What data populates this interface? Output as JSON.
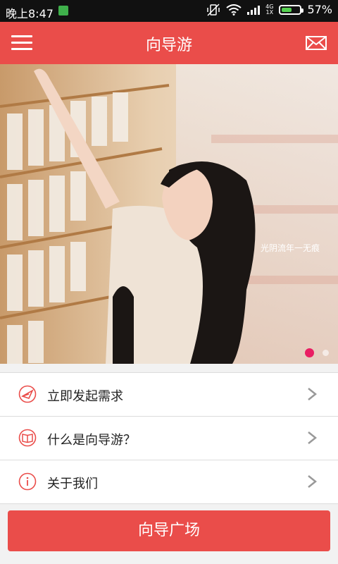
{
  "status_bar": {
    "time": "晚上8:47",
    "battery_percent_label": "57%",
    "battery_level": 0.57,
    "network_top": "4G",
    "network_bottom": "1X"
  },
  "header": {
    "title": "向导游",
    "menu_icon": "hamburger-icon",
    "mail_icon": "envelope-icon"
  },
  "banner": {
    "watermark": "光阴流年一无痕",
    "page_indicator": {
      "count": 2,
      "active": 1
    }
  },
  "menu": {
    "items": [
      {
        "label": "立即发起需求",
        "icon": "send-request-icon"
      },
      {
        "label": "什么是向导游？",
        "icon": "book-icon"
      },
      {
        "label": "关于我们",
        "icon": "info-icon"
      }
    ]
  },
  "bottom_button": {
    "label": "向导广场"
  },
  "colors": {
    "accent": "#ea4d4a",
    "indicator_active": "#e91e63"
  }
}
